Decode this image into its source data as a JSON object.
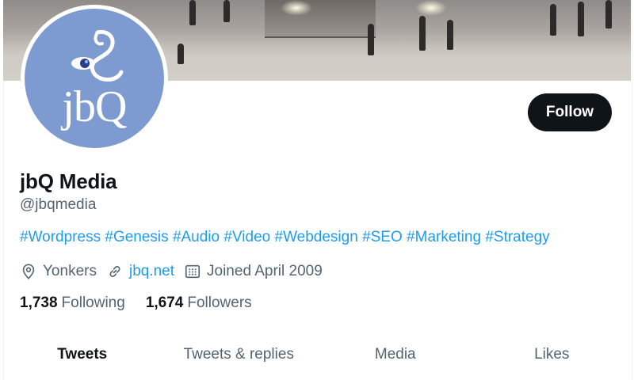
{
  "profile": {
    "name": "jbQ Media",
    "handle": "@jbqmedia",
    "avatar_text": "jbQ",
    "follow_label": "Follow"
  },
  "bio": {
    "hashtags": [
      "#Wordpress",
      "#Genesis",
      "#Audio",
      "#Video",
      "#Webdesign",
      "#SEO",
      "#Marketing",
      "#Strategy"
    ]
  },
  "meta": {
    "location": "Yonkers",
    "url": "jbq.net",
    "joined": "Joined April 2009"
  },
  "counts": {
    "following_count": "1,738",
    "following_label": "Following",
    "followers_count": "1,674",
    "followers_label": "Followers"
  },
  "tabs": [
    {
      "label": "Tweets",
      "active": true
    },
    {
      "label": "Tweets & replies",
      "active": false
    },
    {
      "label": "Media",
      "active": false
    },
    {
      "label": "Likes",
      "active": false
    }
  ],
  "colors": {
    "accent": "#1d9bf0",
    "text": "#0f1419",
    "muted": "#536471",
    "avatar_bg": "#7d9bd0"
  },
  "icons": {
    "location": "location-pin-icon",
    "url": "link-icon",
    "joined": "calendar-icon"
  }
}
